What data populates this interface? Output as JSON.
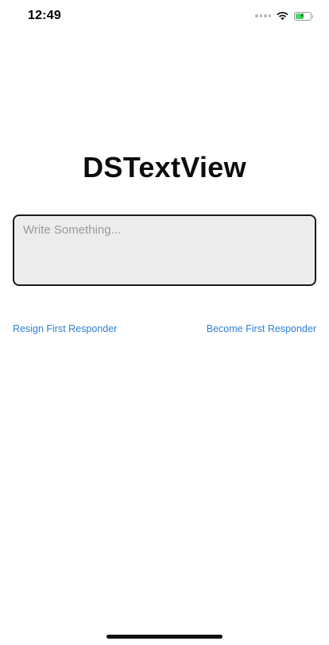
{
  "status_bar": {
    "time": "12:49",
    "battery_level": 0.55,
    "battery_color": "#4cd964",
    "icons": [
      "signal-dots-icon",
      "wifi-icon",
      "battery-charging-icon"
    ]
  },
  "title": "DSTextView",
  "text_view": {
    "placeholder": "Write Something...",
    "value": ""
  },
  "buttons": {
    "resign": "Resign First Responder",
    "become": "Become First Responder"
  },
  "colors": {
    "link": "#2f7fd8",
    "text_view_bg": "#ececec",
    "text_view_border": "#1a1a1a"
  }
}
